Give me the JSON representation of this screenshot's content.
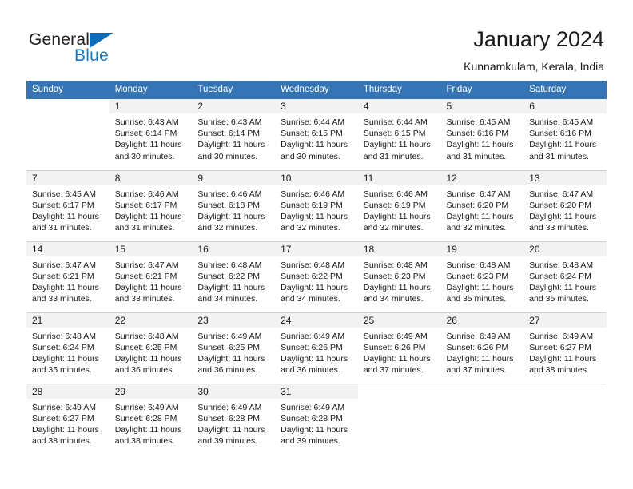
{
  "brand": {
    "name_part1": "General",
    "name_part2": "Blue",
    "accent_color": "#1878c4",
    "triangle_color": "#0b6cb8"
  },
  "header": {
    "title": "January 2024",
    "subtitle": "Kunnamkulam, Kerala, India"
  },
  "theme": {
    "header_row_bg": "#3575b5",
    "daynum_bg": "#f2f2f2",
    "grid_line": "#d0d0d0"
  },
  "calendar": {
    "weekday_headers": [
      "Sunday",
      "Monday",
      "Tuesday",
      "Wednesday",
      "Thursday",
      "Friday",
      "Saturday"
    ],
    "weeks": [
      [
        {
          "day": "",
          "sunrise": "",
          "sunset": "",
          "daylight_line1": "",
          "daylight_line2": ""
        },
        {
          "day": "1",
          "sunrise": "Sunrise: 6:43 AM",
          "sunset": "Sunset: 6:14 PM",
          "daylight_line1": "Daylight: 11 hours",
          "daylight_line2": "and 30 minutes."
        },
        {
          "day": "2",
          "sunrise": "Sunrise: 6:43 AM",
          "sunset": "Sunset: 6:14 PM",
          "daylight_line1": "Daylight: 11 hours",
          "daylight_line2": "and 30 minutes."
        },
        {
          "day": "3",
          "sunrise": "Sunrise: 6:44 AM",
          "sunset": "Sunset: 6:15 PM",
          "daylight_line1": "Daylight: 11 hours",
          "daylight_line2": "and 30 minutes."
        },
        {
          "day": "4",
          "sunrise": "Sunrise: 6:44 AM",
          "sunset": "Sunset: 6:15 PM",
          "daylight_line1": "Daylight: 11 hours",
          "daylight_line2": "and 31 minutes."
        },
        {
          "day": "5",
          "sunrise": "Sunrise: 6:45 AM",
          "sunset": "Sunset: 6:16 PM",
          "daylight_line1": "Daylight: 11 hours",
          "daylight_line2": "and 31 minutes."
        },
        {
          "day": "6",
          "sunrise": "Sunrise: 6:45 AM",
          "sunset": "Sunset: 6:16 PM",
          "daylight_line1": "Daylight: 11 hours",
          "daylight_line2": "and 31 minutes."
        }
      ],
      [
        {
          "day": "7",
          "sunrise": "Sunrise: 6:45 AM",
          "sunset": "Sunset: 6:17 PM",
          "daylight_line1": "Daylight: 11 hours",
          "daylight_line2": "and 31 minutes."
        },
        {
          "day": "8",
          "sunrise": "Sunrise: 6:46 AM",
          "sunset": "Sunset: 6:17 PM",
          "daylight_line1": "Daylight: 11 hours",
          "daylight_line2": "and 31 minutes."
        },
        {
          "day": "9",
          "sunrise": "Sunrise: 6:46 AM",
          "sunset": "Sunset: 6:18 PM",
          "daylight_line1": "Daylight: 11 hours",
          "daylight_line2": "and 32 minutes."
        },
        {
          "day": "10",
          "sunrise": "Sunrise: 6:46 AM",
          "sunset": "Sunset: 6:19 PM",
          "daylight_line1": "Daylight: 11 hours",
          "daylight_line2": "and 32 minutes."
        },
        {
          "day": "11",
          "sunrise": "Sunrise: 6:46 AM",
          "sunset": "Sunset: 6:19 PM",
          "daylight_line1": "Daylight: 11 hours",
          "daylight_line2": "and 32 minutes."
        },
        {
          "day": "12",
          "sunrise": "Sunrise: 6:47 AM",
          "sunset": "Sunset: 6:20 PM",
          "daylight_line1": "Daylight: 11 hours",
          "daylight_line2": "and 32 minutes."
        },
        {
          "day": "13",
          "sunrise": "Sunrise: 6:47 AM",
          "sunset": "Sunset: 6:20 PM",
          "daylight_line1": "Daylight: 11 hours",
          "daylight_line2": "and 33 minutes."
        }
      ],
      [
        {
          "day": "14",
          "sunrise": "Sunrise: 6:47 AM",
          "sunset": "Sunset: 6:21 PM",
          "daylight_line1": "Daylight: 11 hours",
          "daylight_line2": "and 33 minutes."
        },
        {
          "day": "15",
          "sunrise": "Sunrise: 6:47 AM",
          "sunset": "Sunset: 6:21 PM",
          "daylight_line1": "Daylight: 11 hours",
          "daylight_line2": "and 33 minutes."
        },
        {
          "day": "16",
          "sunrise": "Sunrise: 6:48 AM",
          "sunset": "Sunset: 6:22 PM",
          "daylight_line1": "Daylight: 11 hours",
          "daylight_line2": "and 34 minutes."
        },
        {
          "day": "17",
          "sunrise": "Sunrise: 6:48 AM",
          "sunset": "Sunset: 6:22 PM",
          "daylight_line1": "Daylight: 11 hours",
          "daylight_line2": "and 34 minutes."
        },
        {
          "day": "18",
          "sunrise": "Sunrise: 6:48 AM",
          "sunset": "Sunset: 6:23 PM",
          "daylight_line1": "Daylight: 11 hours",
          "daylight_line2": "and 34 minutes."
        },
        {
          "day": "19",
          "sunrise": "Sunrise: 6:48 AM",
          "sunset": "Sunset: 6:23 PM",
          "daylight_line1": "Daylight: 11 hours",
          "daylight_line2": "and 35 minutes."
        },
        {
          "day": "20",
          "sunrise": "Sunrise: 6:48 AM",
          "sunset": "Sunset: 6:24 PM",
          "daylight_line1": "Daylight: 11 hours",
          "daylight_line2": "and 35 minutes."
        }
      ],
      [
        {
          "day": "21",
          "sunrise": "Sunrise: 6:48 AM",
          "sunset": "Sunset: 6:24 PM",
          "daylight_line1": "Daylight: 11 hours",
          "daylight_line2": "and 35 minutes."
        },
        {
          "day": "22",
          "sunrise": "Sunrise: 6:48 AM",
          "sunset": "Sunset: 6:25 PM",
          "daylight_line1": "Daylight: 11 hours",
          "daylight_line2": "and 36 minutes."
        },
        {
          "day": "23",
          "sunrise": "Sunrise: 6:49 AM",
          "sunset": "Sunset: 6:25 PM",
          "daylight_line1": "Daylight: 11 hours",
          "daylight_line2": "and 36 minutes."
        },
        {
          "day": "24",
          "sunrise": "Sunrise: 6:49 AM",
          "sunset": "Sunset: 6:26 PM",
          "daylight_line1": "Daylight: 11 hours",
          "daylight_line2": "and 36 minutes."
        },
        {
          "day": "25",
          "sunrise": "Sunrise: 6:49 AM",
          "sunset": "Sunset: 6:26 PM",
          "daylight_line1": "Daylight: 11 hours",
          "daylight_line2": "and 37 minutes."
        },
        {
          "day": "26",
          "sunrise": "Sunrise: 6:49 AM",
          "sunset": "Sunset: 6:26 PM",
          "daylight_line1": "Daylight: 11 hours",
          "daylight_line2": "and 37 minutes."
        },
        {
          "day": "27",
          "sunrise": "Sunrise: 6:49 AM",
          "sunset": "Sunset: 6:27 PM",
          "daylight_line1": "Daylight: 11 hours",
          "daylight_line2": "and 38 minutes."
        }
      ],
      [
        {
          "day": "28",
          "sunrise": "Sunrise: 6:49 AM",
          "sunset": "Sunset: 6:27 PM",
          "daylight_line1": "Daylight: 11 hours",
          "daylight_line2": "and 38 minutes."
        },
        {
          "day": "29",
          "sunrise": "Sunrise: 6:49 AM",
          "sunset": "Sunset: 6:28 PM",
          "daylight_line1": "Daylight: 11 hours",
          "daylight_line2": "and 38 minutes."
        },
        {
          "day": "30",
          "sunrise": "Sunrise: 6:49 AM",
          "sunset": "Sunset: 6:28 PM",
          "daylight_line1": "Daylight: 11 hours",
          "daylight_line2": "and 39 minutes."
        },
        {
          "day": "31",
          "sunrise": "Sunrise: 6:49 AM",
          "sunset": "Sunset: 6:28 PM",
          "daylight_line1": "Daylight: 11 hours",
          "daylight_line2": "and 39 minutes."
        },
        {
          "day": "",
          "sunrise": "",
          "sunset": "",
          "daylight_line1": "",
          "daylight_line2": ""
        },
        {
          "day": "",
          "sunrise": "",
          "sunset": "",
          "daylight_line1": "",
          "daylight_line2": ""
        },
        {
          "day": "",
          "sunrise": "",
          "sunset": "",
          "daylight_line1": "",
          "daylight_line2": ""
        }
      ]
    ]
  }
}
